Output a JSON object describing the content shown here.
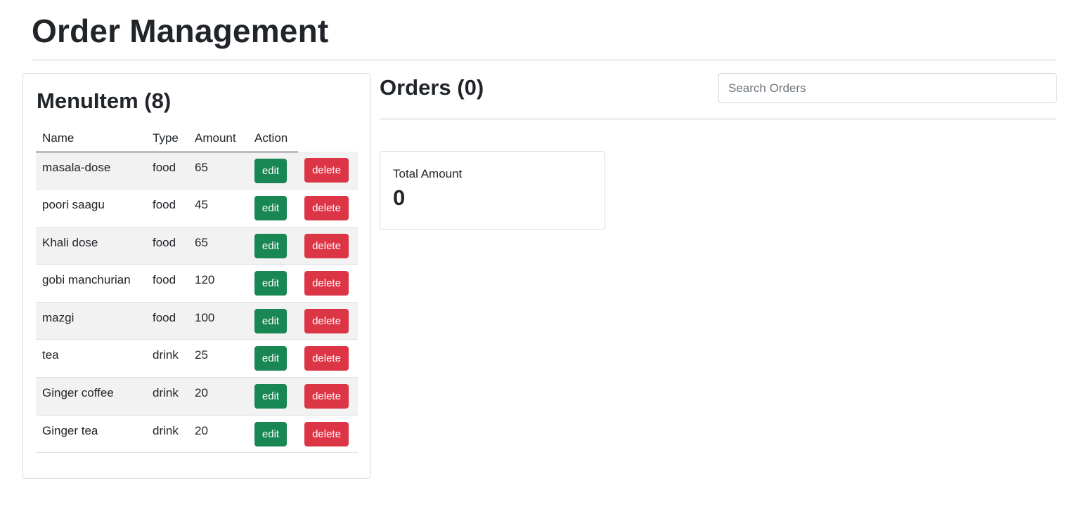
{
  "page": {
    "title": "Order Management"
  },
  "menu": {
    "heading": "MenuItem (8)",
    "columns": {
      "name": "Name",
      "type": "Type",
      "amount": "Amount",
      "action": "Action"
    },
    "edit_label": "edit",
    "delete_label": "delete",
    "items": [
      {
        "name": "masala-dose",
        "type": "food",
        "amount": "65"
      },
      {
        "name": "poori saagu",
        "type": "food",
        "amount": "45"
      },
      {
        "name": "Khali dose",
        "type": "food",
        "amount": "65"
      },
      {
        "name": "gobi manchurian",
        "type": "food",
        "amount": "120"
      },
      {
        "name": "mazgi",
        "type": "food",
        "amount": "100"
      },
      {
        "name": "tea",
        "type": "drink",
        "amount": "25"
      },
      {
        "name": "Ginger coffee",
        "type": "drink",
        "amount": "20"
      },
      {
        "name": "Ginger tea",
        "type": "drink",
        "amount": "20"
      }
    ]
  },
  "orders": {
    "heading": "Orders (0)",
    "search": {
      "placeholder": "Search Orders",
      "value": ""
    },
    "total": {
      "label": "Total Amount",
      "value": "0"
    }
  },
  "colors": {
    "edit": "#198754",
    "delete": "#dc3545",
    "text": "#212529"
  }
}
